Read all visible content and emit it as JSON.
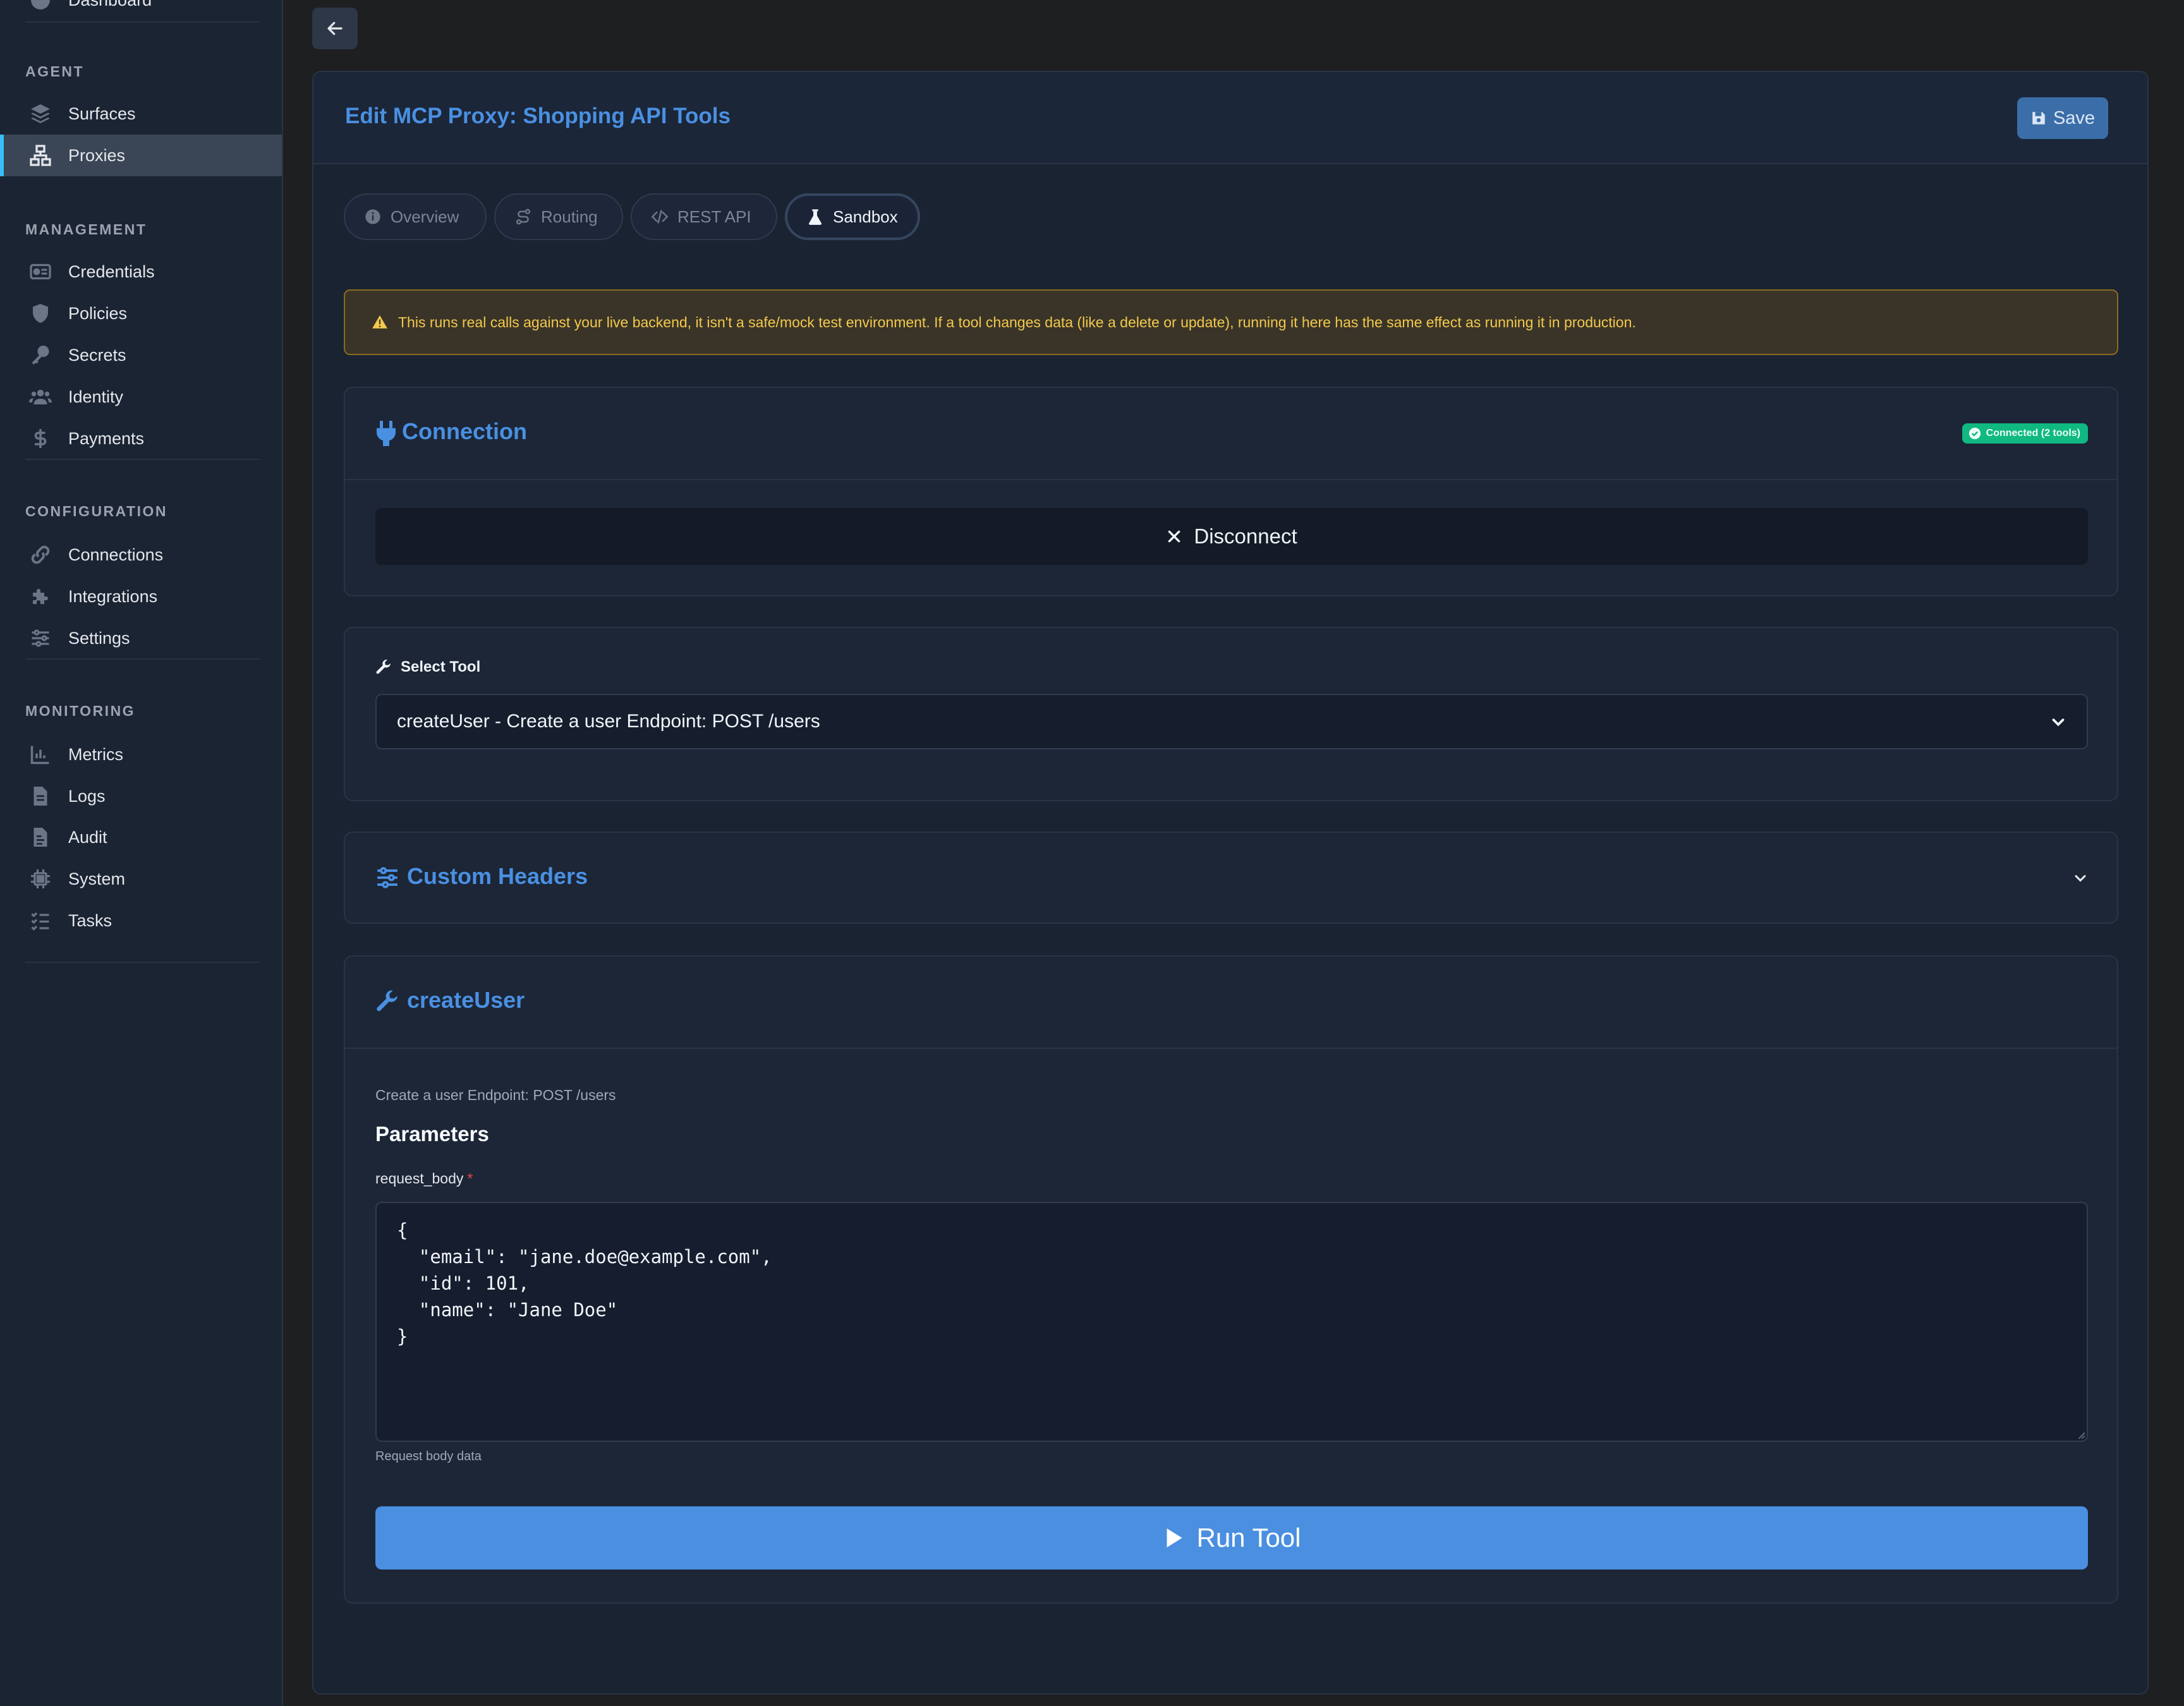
{
  "sidebar": {
    "top_item": "Dashboard",
    "sections": [
      {
        "heading": "AGENT",
        "items": [
          {
            "label": "Surfaces",
            "icon": "layers-icon"
          },
          {
            "label": "Proxies",
            "icon": "network-icon",
            "active": true
          }
        ]
      },
      {
        "heading": "MANAGEMENT",
        "items": [
          {
            "label": "Credentials",
            "icon": "id-card-icon"
          },
          {
            "label": "Policies",
            "icon": "shield-icon"
          },
          {
            "label": "Secrets",
            "icon": "key-icon"
          },
          {
            "label": "Identity",
            "icon": "users-icon"
          },
          {
            "label": "Payments",
            "icon": "dollar-icon"
          }
        ]
      },
      {
        "heading": "CONFIGURATION",
        "items": [
          {
            "label": "Connections",
            "icon": "link-icon"
          },
          {
            "label": "Integrations",
            "icon": "puzzle-icon"
          },
          {
            "label": "Settings",
            "icon": "sliders-icon"
          }
        ]
      },
      {
        "heading": "MONITORING",
        "items": [
          {
            "label": "Metrics",
            "icon": "chart-icon"
          },
          {
            "label": "Logs",
            "icon": "file-icon"
          },
          {
            "label": "Audit",
            "icon": "file-audit-icon"
          },
          {
            "label": "System",
            "icon": "chip-icon"
          },
          {
            "label": "Tasks",
            "icon": "tasks-icon"
          }
        ]
      }
    ]
  },
  "header": {
    "title": "Edit MCP Proxy: Shopping API Tools",
    "save_label": "Save"
  },
  "tabs": [
    {
      "label": "Overview",
      "icon": "info-icon"
    },
    {
      "label": "Routing",
      "icon": "route-icon"
    },
    {
      "label": "REST API",
      "icon": "code-icon"
    },
    {
      "label": "Sandbox",
      "icon": "flask-icon",
      "active": true
    }
  ],
  "warning": "This runs real calls against your live backend, it isn't a safe/mock test environment. If a tool changes data (like a delete or update), running it here has the same effect as running it in production.",
  "connection": {
    "title": "Connection",
    "badge": "Connected (2 tools)",
    "disconnect_label": "Disconnect"
  },
  "tool_select": {
    "label": "Select Tool",
    "value": "createUser - Create a user Endpoint: POST /users"
  },
  "custom_headers": {
    "title": "Custom Headers"
  },
  "tool": {
    "title": "createUser",
    "description": "Create a user Endpoint: POST /users",
    "params_heading": "Parameters",
    "field_label": "request_body",
    "required_mark": "*",
    "request_body": "{\n  \"email\": \"jane.doe@example.com\",\n  \"id\": 101,\n  \"name\": \"Jane Doe\"\n}",
    "hint": "Request body data",
    "run_label": "Run Tool"
  },
  "colors": {
    "accent": "#4a90e2",
    "success": "#10b981",
    "warning": "#f2c94c",
    "active_indicator": "#38bdf8"
  }
}
